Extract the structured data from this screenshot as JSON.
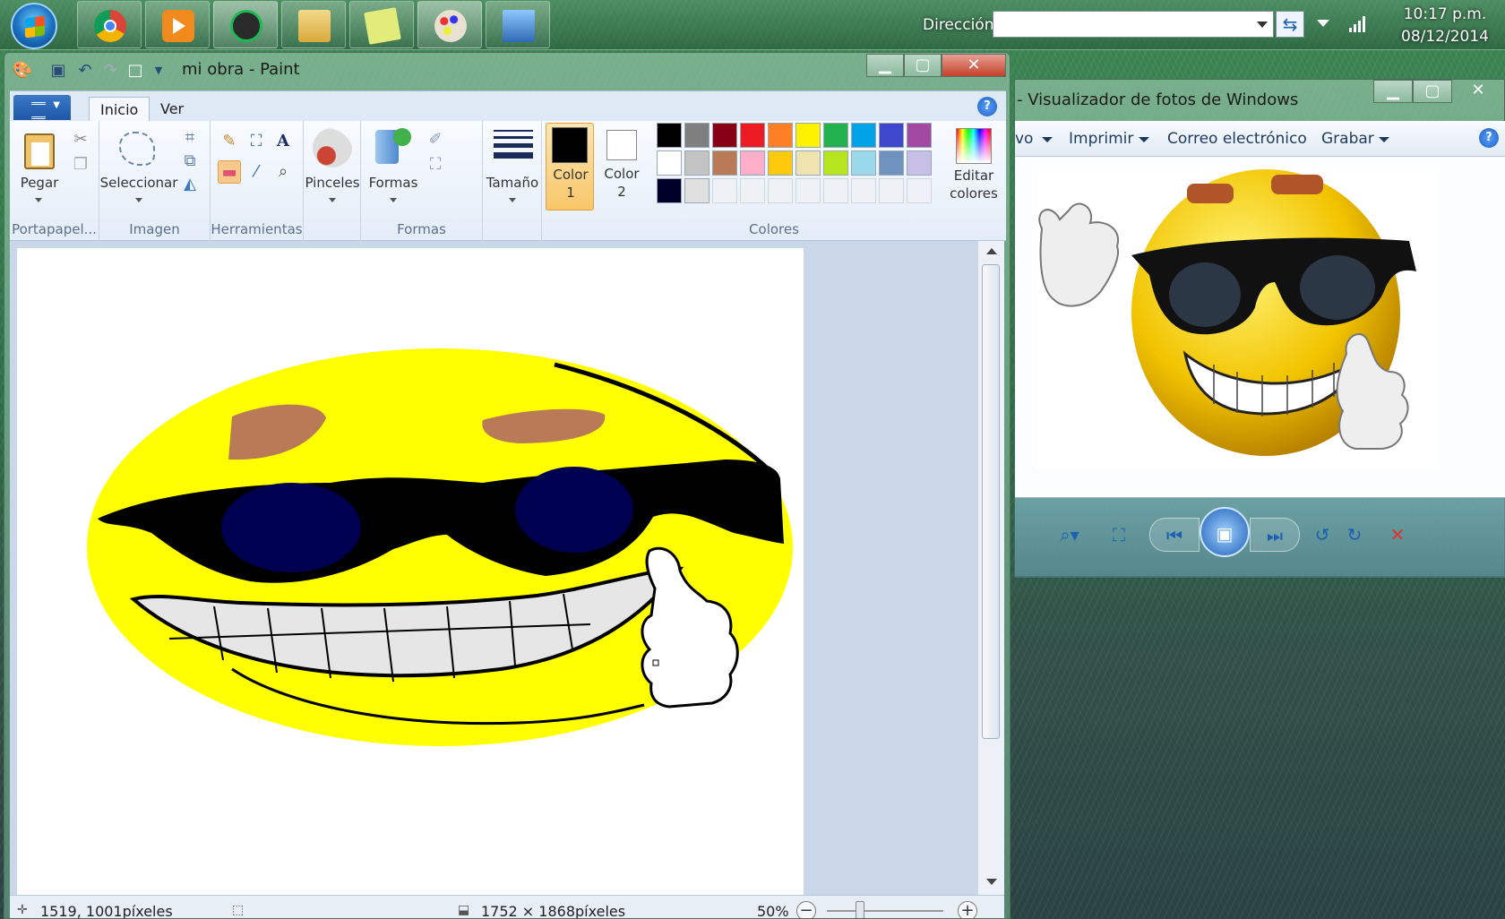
{
  "taskbar": {
    "address_label": "Dirección",
    "address_value": "",
    "time": "10:17 p.m.",
    "date": "08/12/2014",
    "apps": [
      {
        "name": "chrome",
        "color": "#dd4b39"
      },
      {
        "name": "media-player",
        "color": "#f08a1c"
      },
      {
        "name": "spotify",
        "color": "#1db954"
      },
      {
        "name": "file-explorer",
        "color": "#e8c35a"
      },
      {
        "name": "sticky-notes",
        "color": "#d7e86b"
      },
      {
        "name": "paint",
        "color": "#7fb2e5"
      },
      {
        "name": "photo-viewer",
        "color": "#3f7fc4"
      }
    ]
  },
  "paint": {
    "title": "mi obra - Paint",
    "tabs": [
      "Inicio",
      "Ver"
    ],
    "groups": {
      "clipboard": {
        "label": "Portapapel...",
        "paste": "Pegar"
      },
      "image": {
        "label": "Imagen",
        "select": "Seleccionar"
      },
      "tools": {
        "label": "Herramientas"
      },
      "brushes": {
        "label": "Pinceles"
      },
      "shapes": {
        "label": "Formas",
        "shapes_btn": "Formas"
      },
      "size": {
        "label": "Tamaño"
      },
      "colors": {
        "label": "Colores",
        "color1_l1": "Color",
        "color1_l2": "1",
        "color2_l1": "Color",
        "color2_l2": "2",
        "edit_l1": "Editar",
        "edit_l2": "colores",
        "color1": "#000000",
        "color2": "#ffffff",
        "palette_row1": [
          "#000000",
          "#7f7f7f",
          "#880015",
          "#ed1c24",
          "#ff7f27",
          "#fff200",
          "#22b14c",
          "#00a2e8",
          "#3f48cc",
          "#a349a4"
        ],
        "palette_row2": [
          "#ffffff",
          "#c3c3c3",
          "#b97a57",
          "#ffaec9",
          "#ffc90e",
          "#efe4b0",
          "#b5e61d",
          "#99d9ea",
          "#7092be",
          "#c8bfe7"
        ],
        "palette_row3": [
          "#00002a",
          "#e0e0e0"
        ]
      }
    },
    "status": {
      "cursor": "1519, 1001píxeles",
      "size": "1752 × 1868píxeles",
      "zoom": "50%"
    }
  },
  "viewer": {
    "title": "- Visualizador de fotos de Windows",
    "menu": [
      "vo",
      "Imprimir",
      "Correo electrónico",
      "Grabar"
    ]
  }
}
